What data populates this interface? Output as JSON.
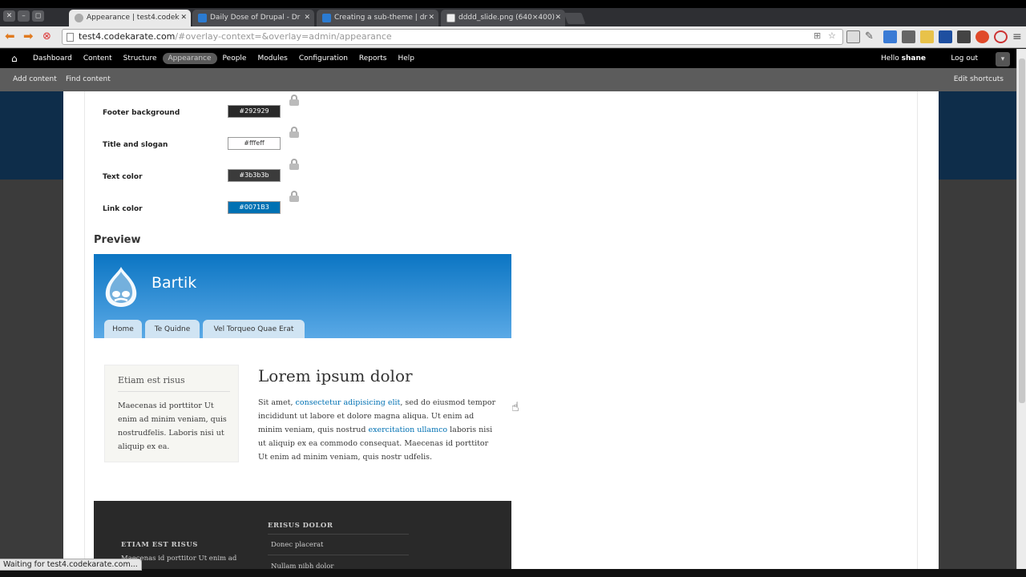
{
  "browser": {
    "tabs": [
      {
        "title": "Appearance | test4.codek",
        "active": true
      },
      {
        "title": "Daily Dose of Drupal - Dr",
        "active": false
      },
      {
        "title": "Creating a sub-theme | dr",
        "active": false
      },
      {
        "title": "dddd_slide.png (640×400)",
        "active": false
      }
    ],
    "url": "test4.codekarate.com",
    "url_rest": "/#overlay-context=&overlay=admin/appearance",
    "status": "Waiting for test4.codekarate.com..."
  },
  "admin_menu": {
    "items": [
      "Dashboard",
      "Content",
      "Structure",
      "Appearance",
      "People",
      "Modules",
      "Configuration",
      "Reports",
      "Help"
    ],
    "active": "Appearance",
    "hello": "Hello",
    "user": "shane",
    "logout": "Log out"
  },
  "shortcuts": {
    "add_content": "Add content",
    "find_content": "Find content",
    "edit_shortcuts": "Edit shortcuts"
  },
  "color_fields": [
    {
      "label": "Footer background",
      "value": "#292929",
      "bg": "#292929",
      "fg": "#ffffff"
    },
    {
      "label": "Title and slogan",
      "value": "#fffeff",
      "bg": "#fffeff",
      "fg": "#333333"
    },
    {
      "label": "Text color",
      "value": "#3b3b3b",
      "bg": "#3b3b3b",
      "fg": "#ffffff"
    },
    {
      "label": "Link color",
      "value": "#0071B3",
      "bg": "#0071B3",
      "fg": "#ffffff"
    }
  ],
  "preview": {
    "heading": "Preview",
    "site_name": "Bartik",
    "tabs": [
      "Home",
      "Te Quidne",
      "Vel Torqueo Quae Erat"
    ],
    "sidebar_title": "Etiam est risus",
    "sidebar_text": "Maecenas id porttitor Ut enim ad minim veniam, quis nostrudfelis. Laboris nisi ut aliquip ex ea.",
    "main_title": "Lorem ipsum dolor",
    "main_text_1": "Sit amet, ",
    "main_link_1": "consectetur adipisicing elit",
    "main_text_2": ", sed do eiusmod tempor incididunt ut labore et dolore magna aliqua. Ut enim ad minim veniam, quis nostrud ",
    "main_link_2": "exercitation ullamco",
    "main_text_3": " laboris nisi ut aliquip ex ea commodo consequat. Maecenas id porttitor Ut enim ad minim veniam, quis nostr udfelis.",
    "footer_col1_title": "ETIAM EST RISUS",
    "footer_col1_text": "Maecenas id porttitor Ut enim ad",
    "footer_col2_title": "ERISUS DOLOR",
    "footer_col2_items": [
      "Donec placerat",
      "Nullam nibh dolor"
    ]
  },
  "colors": {
    "accent_blue": "#0071B3",
    "admin_bar": "#000000",
    "shortcut_bar": "#5c5c5c"
  }
}
